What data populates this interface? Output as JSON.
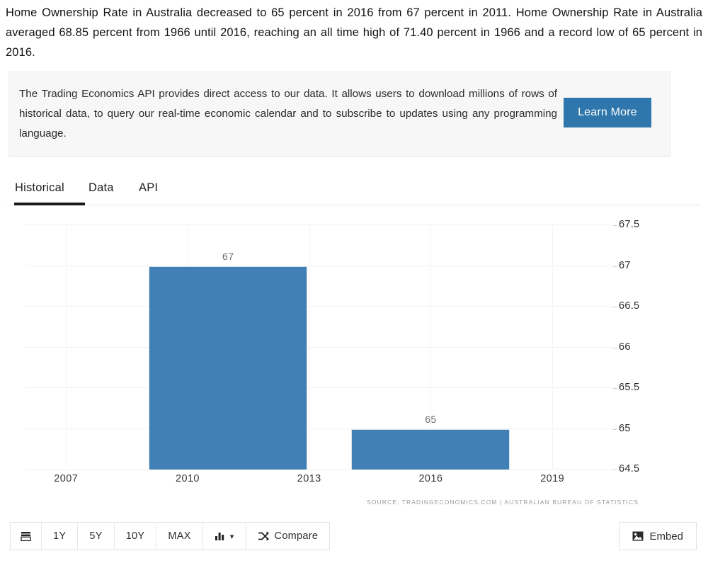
{
  "intro": {
    "paragraph": "Home Ownership Rate in Australia decreased to 65 percent in 2016 from 67 percent in 2011. Home Ownership Rate in Australia averaged 68.85 percent from 1966 until 2016, reaching an all time high of 71.40 percent in 1966 and a record low of 65 percent in 2016."
  },
  "api_promo": {
    "text": "The Trading Economics API provides direct access to our data. It allows users to download millions of rows of historical data, to query our real-time economic calendar and to subscribe to updates using any programming language.",
    "button_label": "Learn More",
    "button_color": "#2e76ab"
  },
  "tabs": {
    "items": [
      {
        "label": "Historical",
        "active": true
      },
      {
        "label": "Data",
        "active": false
      },
      {
        "label": "API",
        "active": false
      }
    ]
  },
  "chart_data": {
    "type": "bar",
    "title": "",
    "xlabel": "",
    "ylabel": "",
    "categories": [
      "2011",
      "2016"
    ],
    "values": [
      67,
      65
    ],
    "x": [
      2011,
      2016
    ],
    "data_labels": [
      "67",
      "65"
    ],
    "xlim": [
      2006,
      2020.5
    ],
    "ylim": [
      64.5,
      67.5
    ],
    "ytick_labels": [
      "67.5",
      "67",
      "66.5",
      "66",
      "65.5",
      "65",
      "64.5"
    ],
    "ytick_values": [
      67.5,
      67,
      66.5,
      66,
      65.5,
      65,
      64.5
    ],
    "xtick_labels": [
      "2007",
      "2010",
      "2013",
      "2016",
      "2019"
    ],
    "xtick_values": [
      2007,
      2010,
      2013,
      2016,
      2019
    ],
    "grid": true,
    "legend": "none",
    "series_color": "#4180b4",
    "source": "SOURCE: TRADINGECONOMICS.COM  |  AUSTRALIAN BUREAU OF STATISTICS"
  },
  "toolbar": {
    "list_icon": "list-icon",
    "ranges": [
      "1Y",
      "5Y",
      "10Y",
      "MAX"
    ],
    "chart_type_icon": "bar-chart-icon",
    "chart_type_caret": "▾",
    "compare_icon": "shuffle-icon",
    "compare_label": "Compare",
    "embed_icon": "image-icon",
    "embed_label": "Embed"
  }
}
